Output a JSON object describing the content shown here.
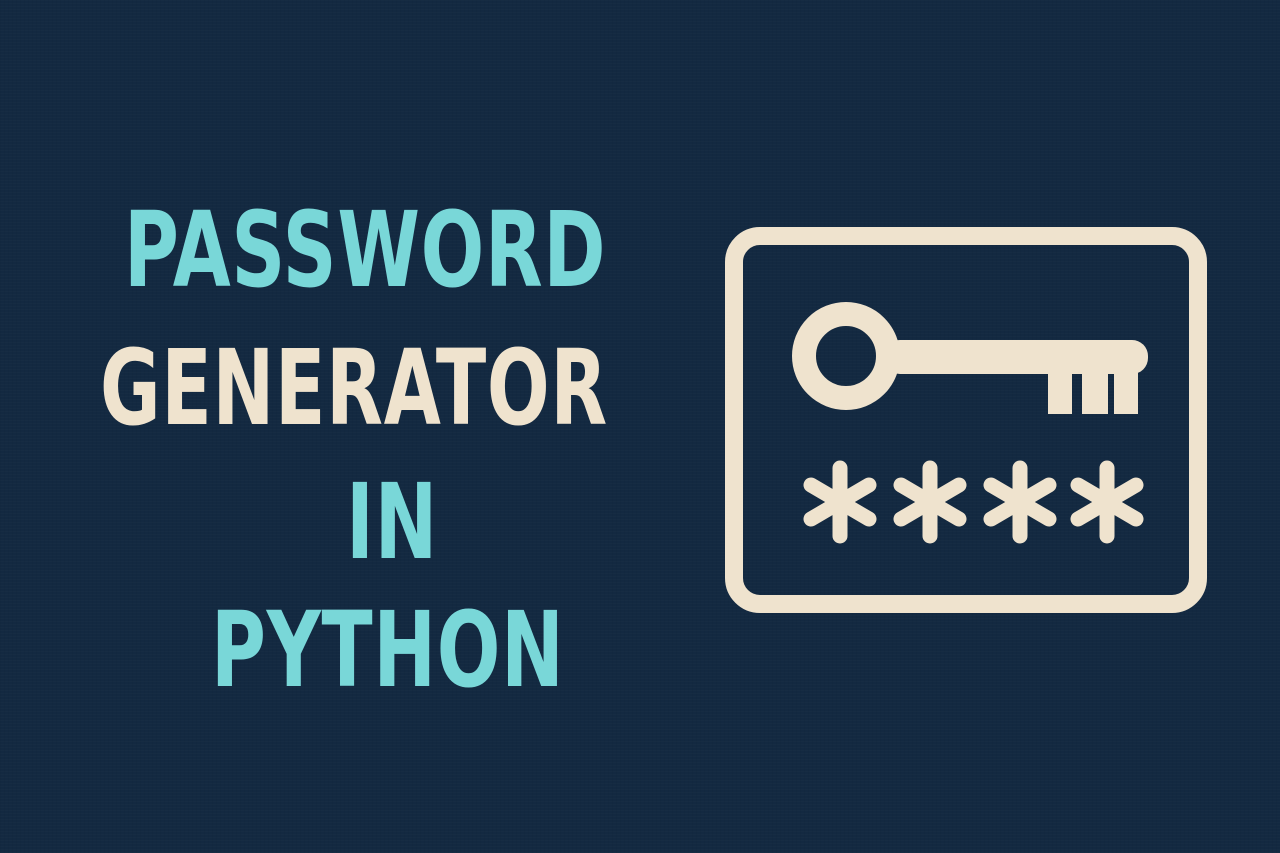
{
  "title": {
    "line1": "PASSWORD",
    "line2": "GENERATOR",
    "line3": "IN",
    "line4": "PYTHON"
  },
  "icon": {
    "name": "key-password-card-icon",
    "mask": "****"
  },
  "colors": {
    "background": "#132941",
    "accent": "#79D7D8",
    "cream": "#EFE3CE"
  }
}
